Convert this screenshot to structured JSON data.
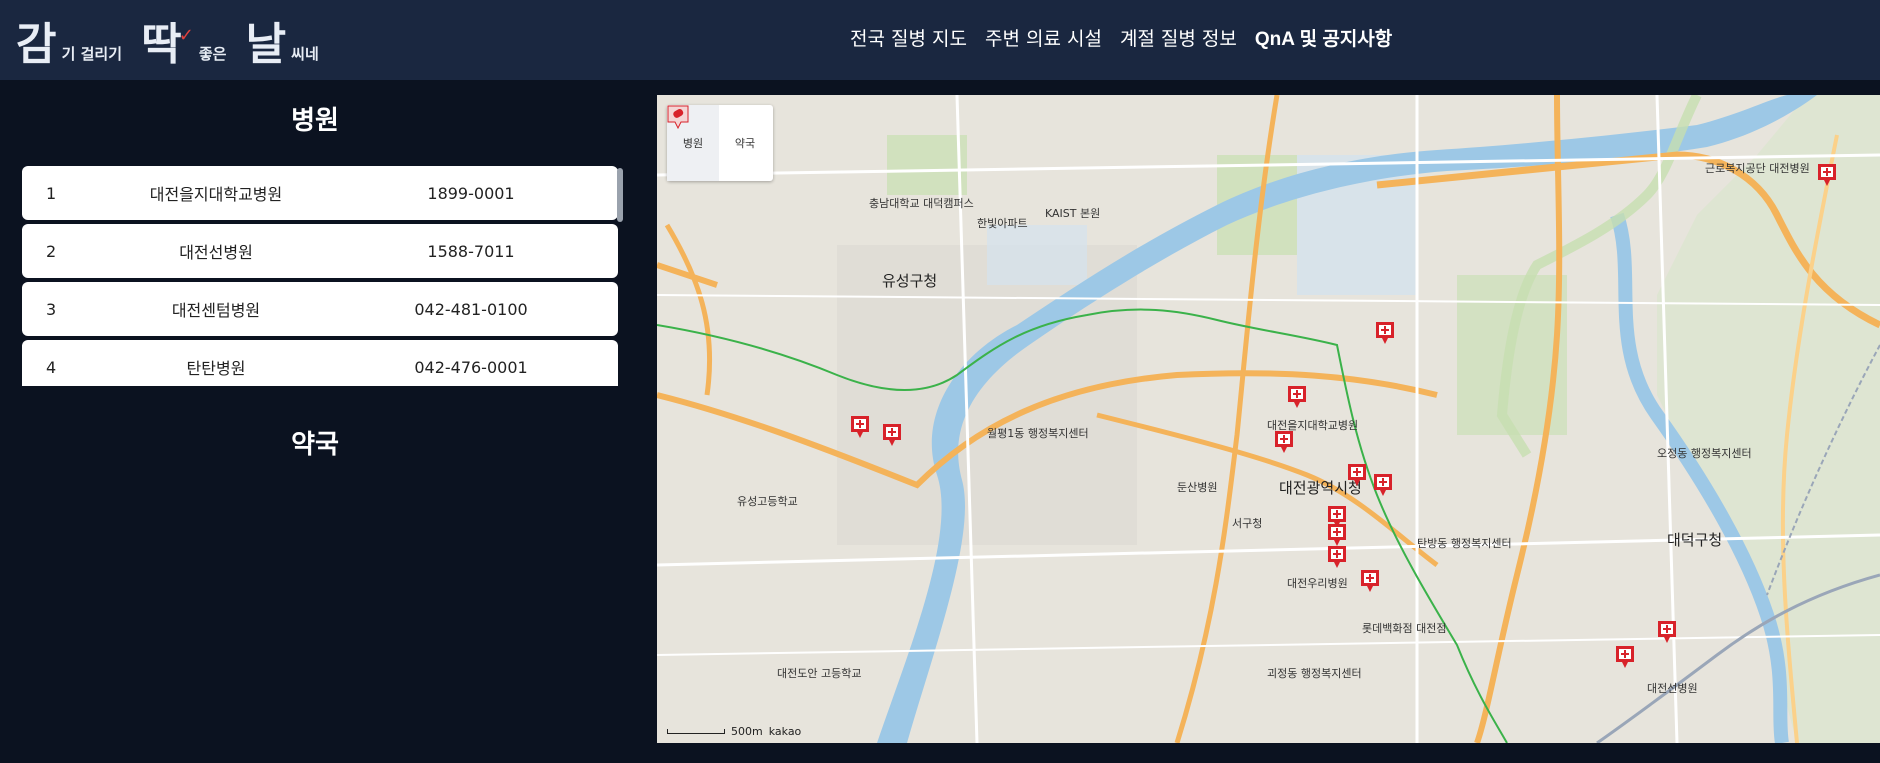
{
  "logo": {
    "big1": "감",
    "small1": "기 걸리기",
    "big2": "딱",
    "check": "✓",
    "small2": "좋은",
    "big3": "날",
    "small3": "씨네"
  },
  "nav": [
    "전국 질병 지도",
    "주변 의료 시설",
    "계절 질병 정보",
    "QnA 및 공지사항"
  ],
  "hospital_section": {
    "title": "병원",
    "rows": [
      {
        "no": "1",
        "name": "대전을지대학교병원",
        "tel": "1899-0001"
      },
      {
        "no": "2",
        "name": "대전선병원",
        "tel": "1588-7011"
      },
      {
        "no": "3",
        "name": "대전센텀병원",
        "tel": "042-481-0100"
      },
      {
        "no": "4",
        "name": "탄탄병원",
        "tel": "042-476-0001"
      }
    ]
  },
  "pharmacy_section": {
    "title": "약국"
  },
  "map": {
    "control": {
      "hospital_label": "병원",
      "pharmacy_label": "약국"
    },
    "scale": {
      "distance": "500m",
      "brand": "kakao"
    },
    "labels": [
      "유성구청",
      "대전광역시청",
      "서구청",
      "대덕구청",
      "대전을지대학교병원",
      "대전선병원",
      "대전우리병원",
      "근로복지공단 대전병원",
      "KAIST 본원",
      "충남대학교 대덕캠퍼스",
      "한빛아파트",
      "롯데백화점 대전점",
      "둔산병원",
      "월평1동 행정복지센터",
      "유성고등학교",
      "탄방동 행정복지센터",
      "오정동 행정복지센터",
      "괴정동 행정복지센터",
      "대전도안 고등학교"
    ],
    "colors": {
      "road_major": "#f4b35a",
      "road_minor": "#ffffff",
      "river": "#9dc8e6",
      "green": "#c7dfb0",
      "subway": "#3bb24a",
      "pin": "#d8222a"
    }
  }
}
